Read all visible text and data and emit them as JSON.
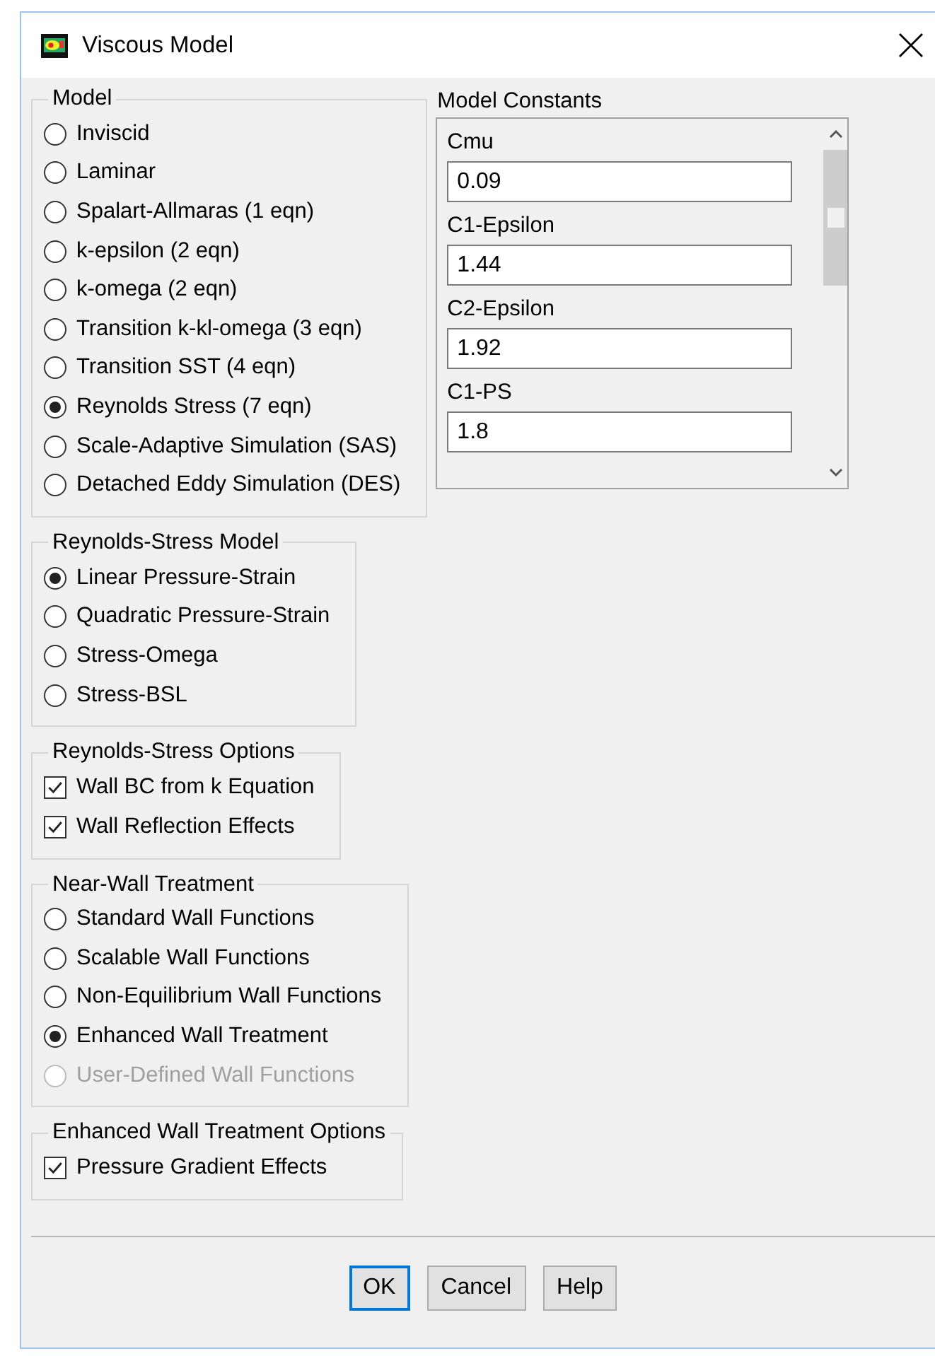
{
  "window": {
    "title": "Viscous Model"
  },
  "groups": [
    {
      "title": "Model",
      "kind": "radio",
      "items": [
        {
          "label": "Inviscid",
          "selected": false
        },
        {
          "label": "Laminar",
          "selected": false
        },
        {
          "label": "Spalart-Allmaras (1 eqn)",
          "selected": false
        },
        {
          "label": "k-epsilon (2 eqn)",
          "selected": false
        },
        {
          "label": "k-omega (2 eqn)",
          "selected": false
        },
        {
          "label": "Transition k-kl-omega (3 eqn)",
          "selected": false
        },
        {
          "label": "Transition SST (4 eqn)",
          "selected": false
        },
        {
          "label": "Reynolds Stress (7 eqn)",
          "selected": true
        },
        {
          "label": "Scale-Adaptive Simulation (SAS)",
          "selected": false
        },
        {
          "label": "Detached Eddy Simulation (DES)",
          "selected": false
        }
      ]
    },
    {
      "title": "Reynolds-Stress Model",
      "kind": "radio",
      "items": [
        {
          "label": "Linear Pressure-Strain",
          "selected": true
        },
        {
          "label": "Quadratic Pressure-Strain",
          "selected": false
        },
        {
          "label": "Stress-Omega",
          "selected": false
        },
        {
          "label": "Stress-BSL",
          "selected": false
        }
      ]
    },
    {
      "title": "Reynolds-Stress Options",
      "kind": "checkbox",
      "items": [
        {
          "label": "Wall BC from k Equation",
          "checked": true
        },
        {
          "label": "Wall Reflection Effects",
          "checked": true
        }
      ]
    },
    {
      "title": "Near-Wall Treatment",
      "kind": "radio",
      "items": [
        {
          "label": "Standard Wall Functions",
          "selected": false,
          "disabled": false
        },
        {
          "label": "Scalable Wall Functions",
          "selected": false,
          "disabled": false
        },
        {
          "label": "Non-Equilibrium Wall Functions",
          "selected": false,
          "disabled": false
        },
        {
          "label": "Enhanced Wall Treatment",
          "selected": true,
          "disabled": false
        },
        {
          "label": "User-Defined Wall Functions",
          "selected": false,
          "disabled": true
        }
      ]
    },
    {
      "title": "Enhanced Wall Treatment Options",
      "kind": "checkbox",
      "items": [
        {
          "label": "Pressure Gradient Effects",
          "checked": true
        }
      ]
    }
  ],
  "model_constants": {
    "title": "Model Constants",
    "items": [
      {
        "label": "Cmu",
        "value": "0.09"
      },
      {
        "label": "C1-Epsilon",
        "value": "1.44"
      },
      {
        "label": "C2-Epsilon",
        "value": "1.92"
      },
      {
        "label": "C1-PS",
        "value": "1.8"
      }
    ]
  },
  "buttons": [
    {
      "label": "OK",
      "focused": true
    },
    {
      "label": "Cancel",
      "focused": false
    },
    {
      "label": "Help",
      "focused": false
    }
  ]
}
